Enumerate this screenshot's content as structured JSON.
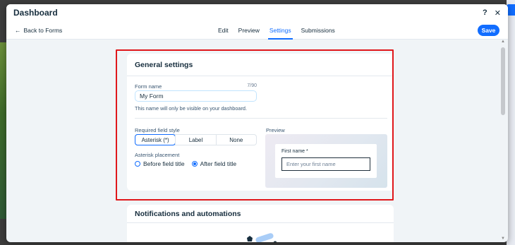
{
  "window": {
    "title": "Dashboard",
    "help_label": "?",
    "close_label": "✕"
  },
  "toolbar": {
    "back_icon": "←",
    "back_label": "Back to Forms",
    "tabs": [
      {
        "label": "Edit",
        "active": false
      },
      {
        "label": "Preview",
        "active": false
      },
      {
        "label": "Settings",
        "active": true
      },
      {
        "label": "Submissions",
        "active": false
      }
    ],
    "save_label": "Save"
  },
  "general_settings": {
    "title": "General settings",
    "form_name_label": "Form name",
    "form_name_counter": "7/90",
    "form_name_value": "My Form",
    "form_name_help": "This name will only be visible on your dashboard.",
    "required_field_style_label": "Required field style",
    "required_field_style_options": [
      "Asterisk (*)",
      "Label",
      "None"
    ],
    "required_field_style_selected": "Asterisk (*)",
    "asterisk_placement_label": "Asterisk placement",
    "asterisk_placement_options": [
      "Before field title",
      "After field title"
    ],
    "asterisk_placement_selected": "After field title",
    "preview_label": "Preview",
    "preview_field_label": "First name *",
    "preview_field_placeholder": "Enter your first name"
  },
  "notifications": {
    "title": "Notifications and automations"
  },
  "colors": {
    "accent": "#116dff",
    "highlight_border": "#e0171b",
    "modal_background": "#f0f4f7"
  }
}
